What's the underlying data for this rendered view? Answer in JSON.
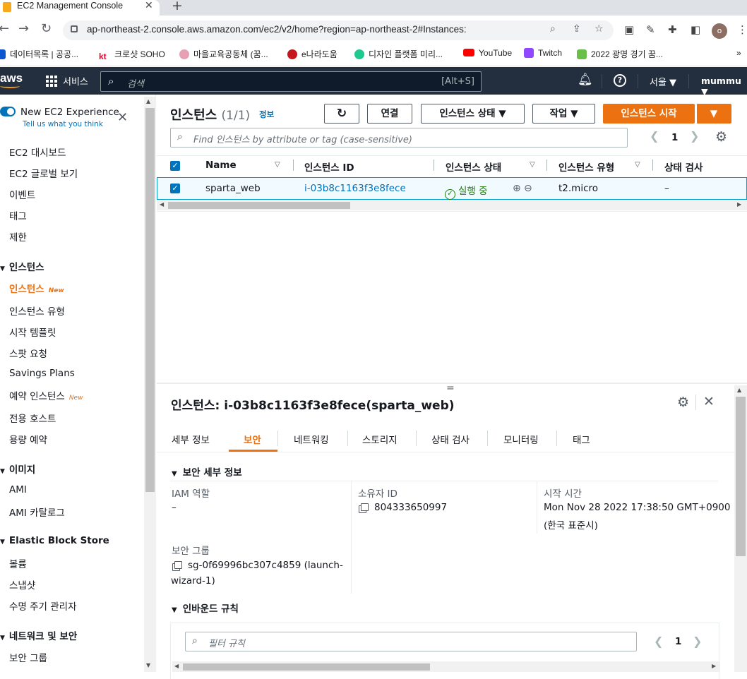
{
  "browser": {
    "tab_title": "EC2 Management Console",
    "tab_close": "✕",
    "new_tab": "+",
    "url": "ap-northeast-2.console.aws.amazon.com/ec2/v2/home?region=ap-northeast-2#Instances:",
    "profile_initial": "o",
    "bookmarks": [
      "데이터목록 | 공공...",
      "크로샷 SOHO",
      "마을교육공동체 (꿈...",
      "e나라도움",
      "디자인 플랫폼 미리...",
      "YouTube",
      "Twitch",
      "2022 광명 경기 꿈..."
    ],
    "bookmark_more": "»"
  },
  "aws": {
    "logo": "aws",
    "services": "서비스",
    "search_placeholder": "검색",
    "search_shortcut": "[Alt+S]",
    "region": "서울 ▼",
    "user": "mummu ▼"
  },
  "sidebar": {
    "new_experience": "New EC2 Experience",
    "tell_us": "Tell us what you think",
    "close": "✕",
    "top_items": [
      "EC2 대시보드",
      "EC2 글로벌 보기",
      "이벤트",
      "태그",
      "제한"
    ],
    "section_instances": "인스턴스",
    "instances_items": [
      "인스턴스",
      "인스턴스 유형",
      "시작 템플릿",
      "스팟 요청",
      "Savings Plans",
      "예약 인스턴스",
      "전용 호스트",
      "용량 예약"
    ],
    "new_badge": "New",
    "section_images": "이미지",
    "images_items": [
      "AMI",
      "AMI 카탈로그"
    ],
    "section_ebs": "Elastic Block Store",
    "ebs_items": [
      "볼륨",
      "스냅샷",
      "수명 주기 관리자"
    ],
    "section_network": "네트워크 및 보안",
    "network_items": [
      "보안 그룹"
    ]
  },
  "instances": {
    "title": "인스턴스",
    "count": "(1/1)",
    "info": "정보",
    "btn_connect": "연결",
    "btn_state": "인스턴스 상태 ▼",
    "btn_actions": "작업 ▼",
    "btn_launch": "인스턴스 시작",
    "btn_launch_caret": "▼",
    "filter_placeholder": "Find 인스턴스 by attribute or tag (case-sensitive)",
    "page": "1",
    "columns": [
      "Name",
      "인스턴스 ID",
      "인스턴스 상태",
      "인스턴스 유형",
      "상태 검사"
    ],
    "rows": [
      {
        "name": "sparta_web",
        "id": "i-03b8c1163f3e8fece",
        "state": "실행 중",
        "type": "t2.micro",
        "check": "–"
      }
    ]
  },
  "detail": {
    "title_prefix": "인스턴스: ",
    "title": "i-03b8c1163f3e8fece(sparta_web)",
    "tabs": [
      "세부 정보",
      "보안",
      "네트워킹",
      "스토리지",
      "상태 검사",
      "모니터링",
      "태그"
    ],
    "active_tab": 1,
    "security_section": "보안 세부 정보",
    "iam_label": "IAM 역할",
    "iam_value": "–",
    "owner_label": "소유자 ID",
    "owner_value": "804333650997",
    "launch_label": "시작 시간",
    "launch_value1": "Mon Nov 28 2022 17:38:50 GMT+0900",
    "launch_value2": "(한국 표준시)",
    "sg_label": "보안 그룹",
    "sg_value1": "sg-0f69996bc307c4859 (launch-",
    "sg_value2": "wizard-1)",
    "inbound_section": "인바운드 규칙",
    "rule_filter_placeholder": "필터 규칙",
    "rule_page": "1"
  },
  "colors": {
    "accent": "#ec7211",
    "link": "#0073bb",
    "header": "#232f3e",
    "running": "#1d8102"
  }
}
